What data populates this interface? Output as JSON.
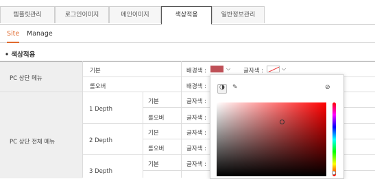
{
  "tabs": [
    "템플릿관리",
    "로그인이미지",
    "메인이미지",
    "색상적용",
    "일반정보관리"
  ],
  "subtabs": [
    "Site",
    "Manage"
  ],
  "section_title": "• 색상적용",
  "rows": {
    "pc_top_menu": "PC 상단 메뉴",
    "pc_top_all_menu": "PC 상단 전체 메뉴",
    "basic": "기본",
    "rollover": "롤오버",
    "depth1": "1 Depth",
    "depth2": "2 Depth",
    "depth3": "3 Depth",
    "bg_color": "배경색 :",
    "text_color": "글자색 :"
  },
  "colors": {
    "selected_bg": "#bf5057",
    "accent": "#e06a2e"
  }
}
